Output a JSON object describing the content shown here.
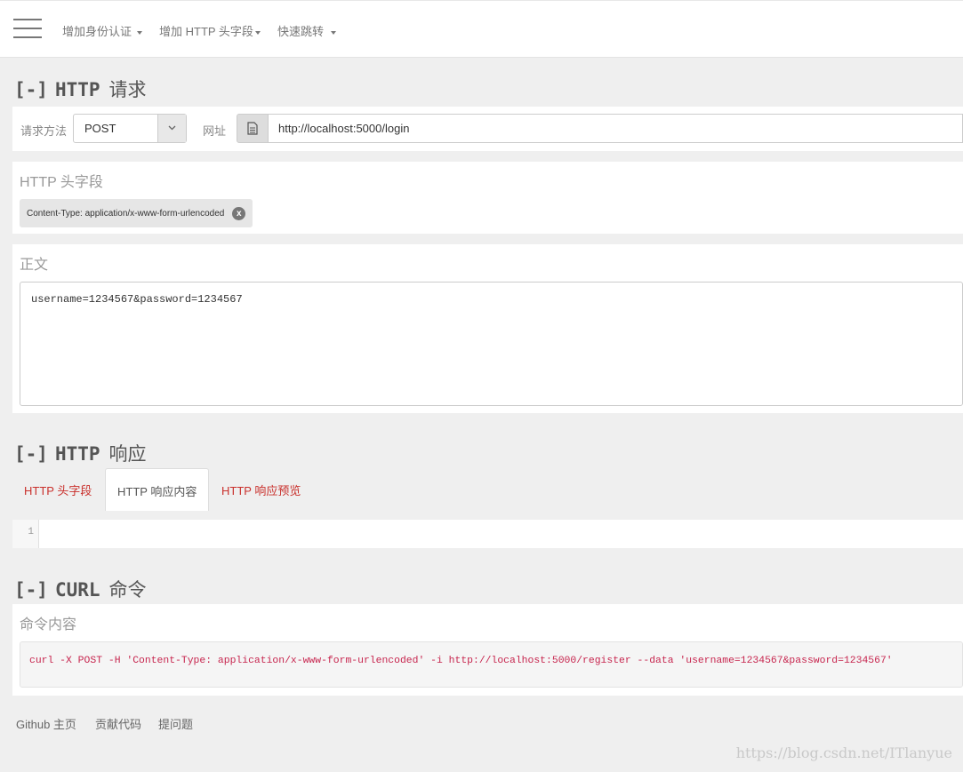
{
  "navbar": {
    "menu": [
      "增加身份认证",
      "增加 HTTP 头字段",
      "快速跳转"
    ]
  },
  "request_section": {
    "bracket": "[-]",
    "title_word": "HTTP",
    "title_cn": "请求",
    "method_label": "请求方法",
    "method_value": "POST",
    "url_label": "网址",
    "url_value": "http://localhost:5000/login"
  },
  "headers_panel": {
    "heading": "HTTP 头字段",
    "chip_text": "Content-Type: application/x-www-form-urlencoded",
    "chip_close": "x"
  },
  "body_panel": {
    "heading": "正文",
    "content": "username=1234567&password=1234567"
  },
  "response_section": {
    "bracket": "[-]",
    "title_word": "HTTP",
    "title_cn": "响应",
    "tabs": [
      "HTTP 头字段",
      "HTTP 响应内容",
      "HTTP 响应预览"
    ],
    "active_tab": 1,
    "line_number": "1"
  },
  "curl_section": {
    "bracket": "[-]",
    "title_word": "CURL",
    "title_cn": "命令",
    "heading": "命令内容",
    "command": "curl -X POST -H 'Content-Type: application/x-www-form-urlencoded' -i http://localhost:5000/register --data 'username=1234567&password=1234567'"
  },
  "footer": {
    "links": [
      "Github 主页",
      "贡献代码",
      "提问题"
    ]
  },
  "watermark": "https://blog.csdn.net/ITlanyue",
  "colors": {
    "link_red": "#c9302c",
    "code_red": "#c7254e",
    "background": "#efefef"
  }
}
